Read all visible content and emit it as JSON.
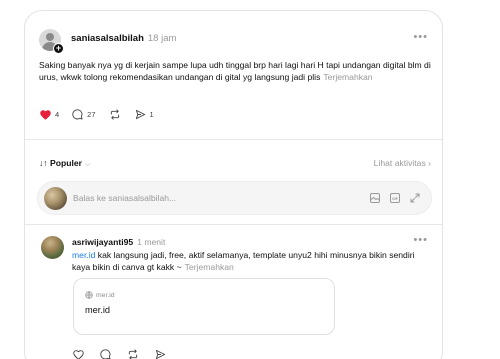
{
  "post": {
    "username": "saniasalsalbilah",
    "time": "18 jam",
    "text": "Saking banyak nya yg di kerjain sampe lupa udh tinggal brp hari lagi hari H tapi undangan digital blm di urus, wkwk tolong rekomendasikan undangan di gital yg langsung jadi plis",
    "translate": "Terjemahkan",
    "likes": "4",
    "comments": "27",
    "shares": "1",
    "like_color": "#e8213a"
  },
  "sort": {
    "label": "Populer",
    "activity": "Lihat aktivitas"
  },
  "reply": {
    "placeholder": "Balas ke saniasalsalbilah..."
  },
  "comment": {
    "username": "asriwijayanti95",
    "time": "1 menit",
    "link_text": "mer.id",
    "text": "kak langsung jadi, free, aktif selamanya, template unyu2 hihi minusnya bikin sendiri kaya bikin di canva gt kakk ~",
    "translate": "Terjemahkan",
    "link_card": {
      "domain": "mer.id",
      "title": "mer.id"
    }
  },
  "icons": [
    "heart-icon",
    "comment-icon",
    "repost-icon",
    "share-icon",
    "globe-icon",
    "image-icon",
    "gif-icon",
    "expand-icon",
    "more-icon",
    "chevron-down-icon"
  ]
}
